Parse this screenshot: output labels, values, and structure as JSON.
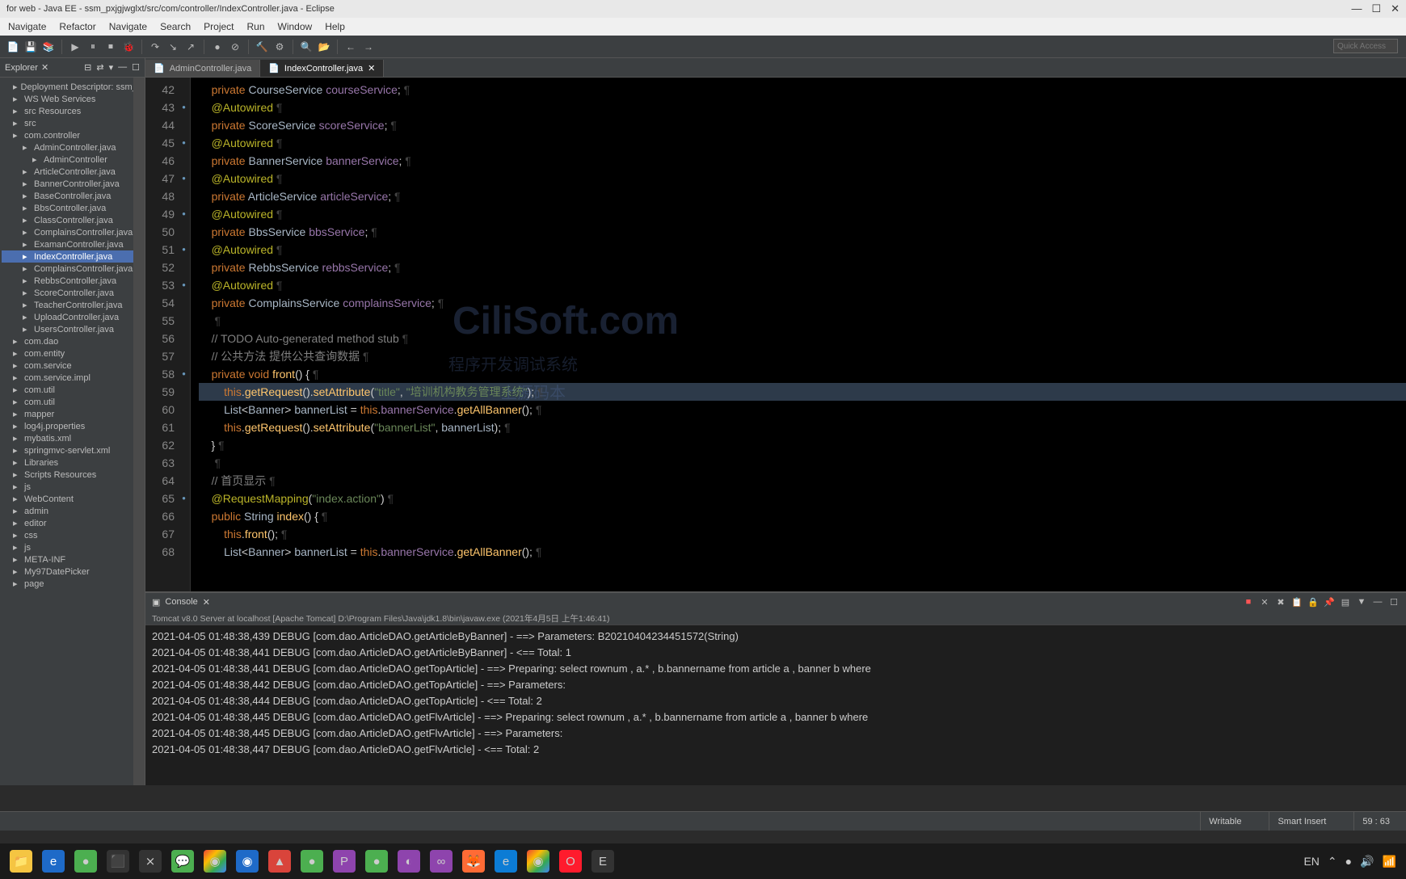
{
  "title": "for web - Java EE - ssm_pxjgjwglxt/src/com/controller/IndexController.java - Eclipse",
  "menus": [
    "Navigate",
    "Refactor",
    "Navigate",
    "Search",
    "Project",
    "Run",
    "Window",
    "Help"
  ],
  "quick_access_placeholder": "Quick Access",
  "explorer": {
    "tab": "Explorer",
    "items": [
      {
        "label": "Deployment Descriptor: ssm_pxjgjwgl",
        "lvl": 1
      },
      {
        "label": "WS Web Services",
        "lvl": 1
      },
      {
        "label": "src Resources",
        "lvl": 1
      },
      {
        "label": "src",
        "lvl": 1
      },
      {
        "label": "com.controller",
        "lvl": 1
      },
      {
        "label": "AdminController.java",
        "lvl": 2
      },
      {
        "label": "AdminController",
        "lvl": 3
      },
      {
        "label": "ArticleController.java",
        "lvl": 2
      },
      {
        "label": "BannerController.java",
        "lvl": 2
      },
      {
        "label": "BaseController.java",
        "lvl": 2
      },
      {
        "label": "BbsController.java",
        "lvl": 2
      },
      {
        "label": "ClassController.java",
        "lvl": 2
      },
      {
        "label": "ComplainsController.java",
        "lvl": 2
      },
      {
        "label": "ExamanController.java",
        "lvl": 2
      },
      {
        "label": "IndexController.java",
        "lvl": 2,
        "sel": true
      },
      {
        "label": "ComplainsController.java",
        "lvl": 2
      },
      {
        "label": "RebbsController.java",
        "lvl": 2
      },
      {
        "label": "ScoreController.java",
        "lvl": 2
      },
      {
        "label": "TeacherController.java",
        "lvl": 2
      },
      {
        "label": "UploadController.java",
        "lvl": 2
      },
      {
        "label": "UsersController.java",
        "lvl": 2
      },
      {
        "label": "com.dao",
        "lvl": 1
      },
      {
        "label": "com.entity",
        "lvl": 1
      },
      {
        "label": "com.service",
        "lvl": 1
      },
      {
        "label": "com.service.impl",
        "lvl": 1
      },
      {
        "label": "com.util",
        "lvl": 1
      },
      {
        "label": "com.util",
        "lvl": 1
      },
      {
        "label": "mapper",
        "lvl": 1
      },
      {
        "label": "log4j.properties",
        "lvl": 1
      },
      {
        "label": "mybatis.xml",
        "lvl": 1
      },
      {
        "label": "springmvc-servlet.xml",
        "lvl": 1
      },
      {
        "label": "Libraries",
        "lvl": 1
      },
      {
        "label": "Scripts Resources",
        "lvl": 1
      },
      {
        "label": "js",
        "lvl": 1
      },
      {
        "label": "WebContent",
        "lvl": 1
      },
      {
        "label": "admin",
        "lvl": 1
      },
      {
        "label": "editor",
        "lvl": 1
      },
      {
        "label": "css",
        "lvl": 1
      },
      {
        "label": "js",
        "lvl": 1
      },
      {
        "label": "META-INF",
        "lvl": 1
      },
      {
        "label": "My97DatePicker",
        "lvl": 1
      },
      {
        "label": "page",
        "lvl": 1
      }
    ]
  },
  "tabs": [
    {
      "label": "AdminController.java",
      "active": false
    },
    {
      "label": "IndexController.java",
      "active": true
    }
  ],
  "code_lines": [
    {
      "n": 42,
      "h": "<span class='kw'>private</span> <span class='type'>CourseService</span> <span class='field'>courseService</span>;"
    },
    {
      "n": 43,
      "mark": true,
      "h": "<span class='ann'>@Autowired</span>"
    },
    {
      "n": 44,
      "h": "<span class='kw'>private</span> <span class='type'>ScoreService</span> <span class='field'>scoreService</span>;"
    },
    {
      "n": 45,
      "mark": true,
      "h": "<span class='ann'>@Autowired</span>"
    },
    {
      "n": 46,
      "h": "<span class='kw'>private</span> <span class='type'>BannerService</span> <span class='field'>bannerService</span>;"
    },
    {
      "n": 47,
      "mark": true,
      "h": "<span class='ann'>@Autowired</span>"
    },
    {
      "n": 48,
      "h": "<span class='kw'>private</span> <span class='type'>ArticleService</span> <span class='field'>articleService</span>;"
    },
    {
      "n": 49,
      "mark": true,
      "h": "<span class='ann'>@Autowired</span>"
    },
    {
      "n": 50,
      "h": "<span class='kw'>private</span> <span class='type'>BbsService</span> <span class='field'>bbsService</span>;"
    },
    {
      "n": 51,
      "mark": true,
      "h": "<span class='ann'>@Autowired</span>"
    },
    {
      "n": 52,
      "h": "<span class='kw'>private</span> <span class='type'>RebbsService</span> <span class='field'>rebbsService</span>;"
    },
    {
      "n": 53,
      "mark": true,
      "h": "<span class='ann'>@Autowired</span>"
    },
    {
      "n": 54,
      "h": "<span class='kw'>private</span> <span class='type'>ComplainsService</span> <span class='field'>complainsService</span>;"
    },
    {
      "n": 55,
      "h": ""
    },
    {
      "n": 56,
      "h": "<span class='cmt'>// TODO Auto-generated method stub</span>"
    },
    {
      "n": 57,
      "h": "<span class='cmt'>// 公共方法 提供公共查询数据</span>"
    },
    {
      "n": 58,
      "mark": true,
      "h": "<span class='kw'>private</span> <span class='kw'>void</span> <span class='fn'>front</span>() {"
    },
    {
      "n": 59,
      "hl": true,
      "h": "    <span class='kw'>this</span>.<span class='fn'>getRequest</span>().<span class='fn'>setAttribute</span>(<span class='str'>\"title\"</span>, <span class='str'>\"培训机构教务管理系统\"</span>);"
    },
    {
      "n": 60,
      "h": "    <span class='type'>List</span>&lt;<span class='type'>Banner</span>&gt; <span class='plain'>bannerList</span> = <span class='kw'>this</span>.<span class='field'>bannerService</span>.<span class='fn'>getAllBanner</span>();"
    },
    {
      "n": 61,
      "h": "    <span class='kw'>this</span>.<span class='fn'>getRequest</span>().<span class='fn'>setAttribute</span>(<span class='str'>\"bannerList\"</span>, <span class='plain'>bannerList</span>);"
    },
    {
      "n": 62,
      "h": "}"
    },
    {
      "n": 63,
      "h": ""
    },
    {
      "n": 64,
      "h": "<span class='cmt'>// 首页显示</span>"
    },
    {
      "n": 65,
      "mark": true,
      "h": "<span class='ann'>@RequestMapping</span>(<span class='str'>\"index.action\"</span>)"
    },
    {
      "n": 66,
      "h": "<span class='kw'>public</span> <span class='type'>String</span> <span class='fn'>index</span>() {"
    },
    {
      "n": 67,
      "h": "    <span class='kw'>this</span>.<span class='fn'>front</span>();"
    },
    {
      "n": 68,
      "h": "    <span class='type'>List</span>&lt;<span class='type'>Banner</span>&gt; <span class='plain'>bannerList</span> = <span class='kw'>this</span>.<span class='field'>bannerService</span>.<span class='fn'>getAllBanner</span>();"
    }
  ],
  "console": {
    "tab": "Console",
    "status": "Tomcat v8.0 Server at localhost [Apache Tomcat]  D:\\Program Files\\Java\\jdk1.8\\bin\\javaw.exe (2021年4月5日 上午1:46:41)",
    "lines": [
      "2021-04-05 01:48:38,439 DEBUG [com.dao.ArticleDAO.getArticleByBanner] - ==>  Parameters: B20210404234451572(String)",
      "2021-04-05 01:48:38,441 DEBUG [com.dao.ArticleDAO.getArticleByBanner] - <==      Total: 1",
      "2021-04-05 01:48:38,441 DEBUG [com.dao.ArticleDAO.getTopArticle] - ==>  Preparing: select rownum , a.* , b.bannername from article a , banner b where",
      "2021-04-05 01:48:38,442 DEBUG [com.dao.ArticleDAO.getTopArticle] - ==>  Parameters:",
      "2021-04-05 01:48:38,444 DEBUG [com.dao.ArticleDAO.getTopArticle] - <==      Total: 2",
      "2021-04-05 01:48:38,445 DEBUG [com.dao.ArticleDAO.getFlvArticle] - ==>  Preparing: select rownum , a.* , b.bannername from article a , banner b where",
      "2021-04-05 01:48:38,445 DEBUG [com.dao.ArticleDAO.getFlvArticle] - ==>  Parameters:",
      "2021-04-05 01:48:38,447 DEBUG [com.dao.ArticleDAO.getFlvArticle] - <==      Total: 2"
    ]
  },
  "status_bar": {
    "writable": "Writable",
    "insert": "Smart Insert",
    "pos": "59 : 63"
  },
  "watermark": {
    "line1": "CiliSoft.com",
    "line2": "程序开发调试系统",
    "line3": "上源码本"
  },
  "tray_lang": "EN"
}
